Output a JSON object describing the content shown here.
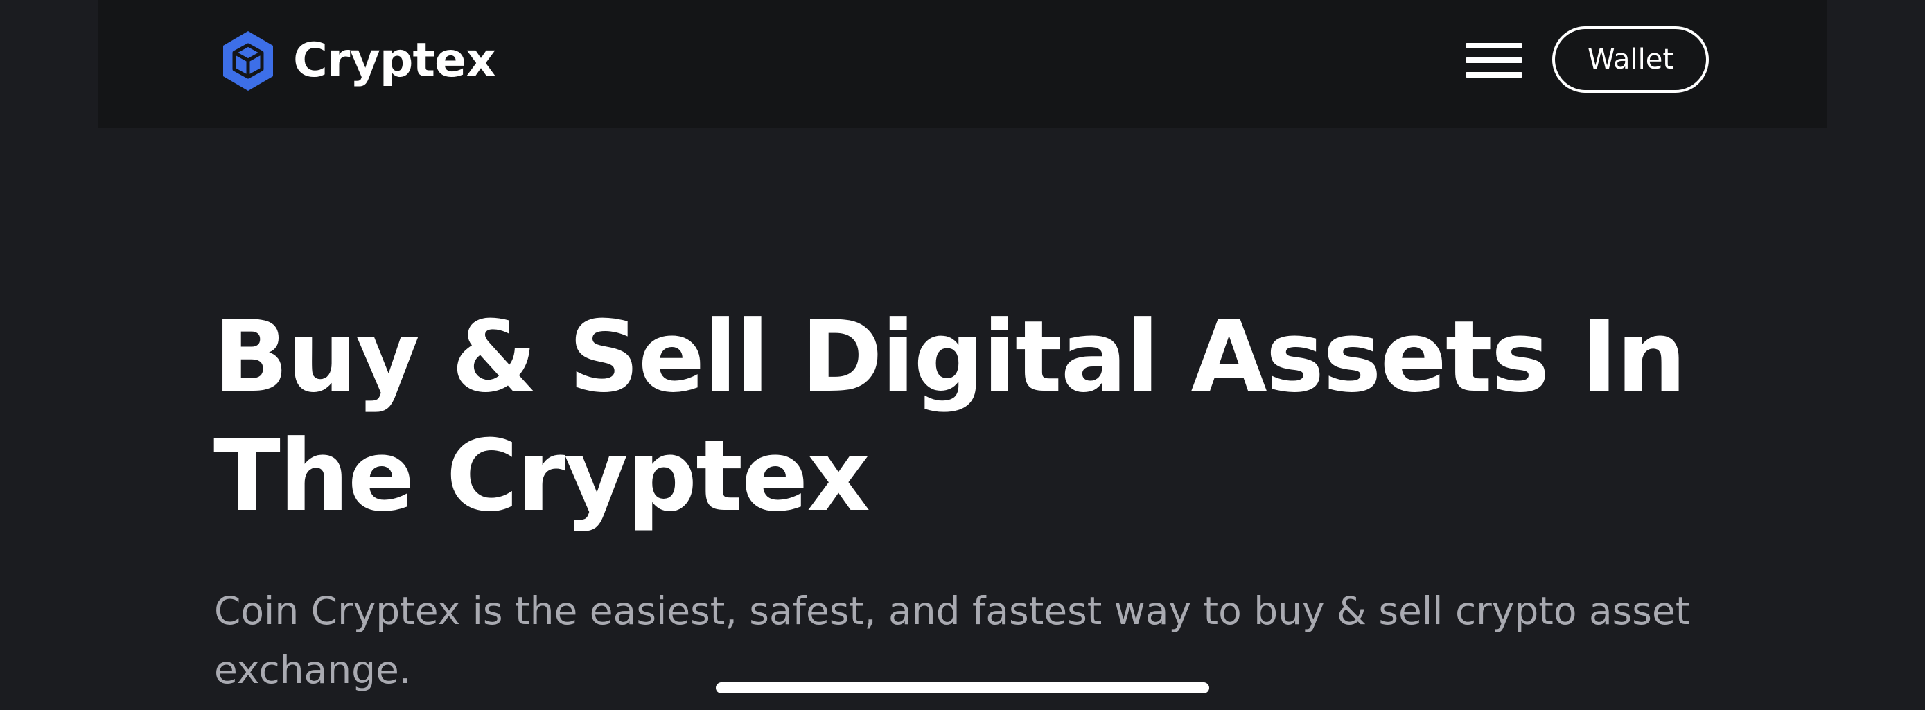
{
  "header": {
    "brand": "Cryptex",
    "wallet_label": "Wallet"
  },
  "hero": {
    "title": "Buy & Sell Digital Assets In The Cryptex",
    "description": "Coin Cryptex is the easiest, safest, and fastest way to buy & sell crypto asset exchange."
  },
  "icons": {
    "logo": "cube-hexagon-icon",
    "menu": "hamburger-menu-icon"
  },
  "colors": {
    "background": "#1b1c20",
    "navbar": "#141517",
    "logo_accent": "#3d6fe8",
    "text_primary": "#ffffff",
    "text_secondary": "#a9aab1"
  }
}
